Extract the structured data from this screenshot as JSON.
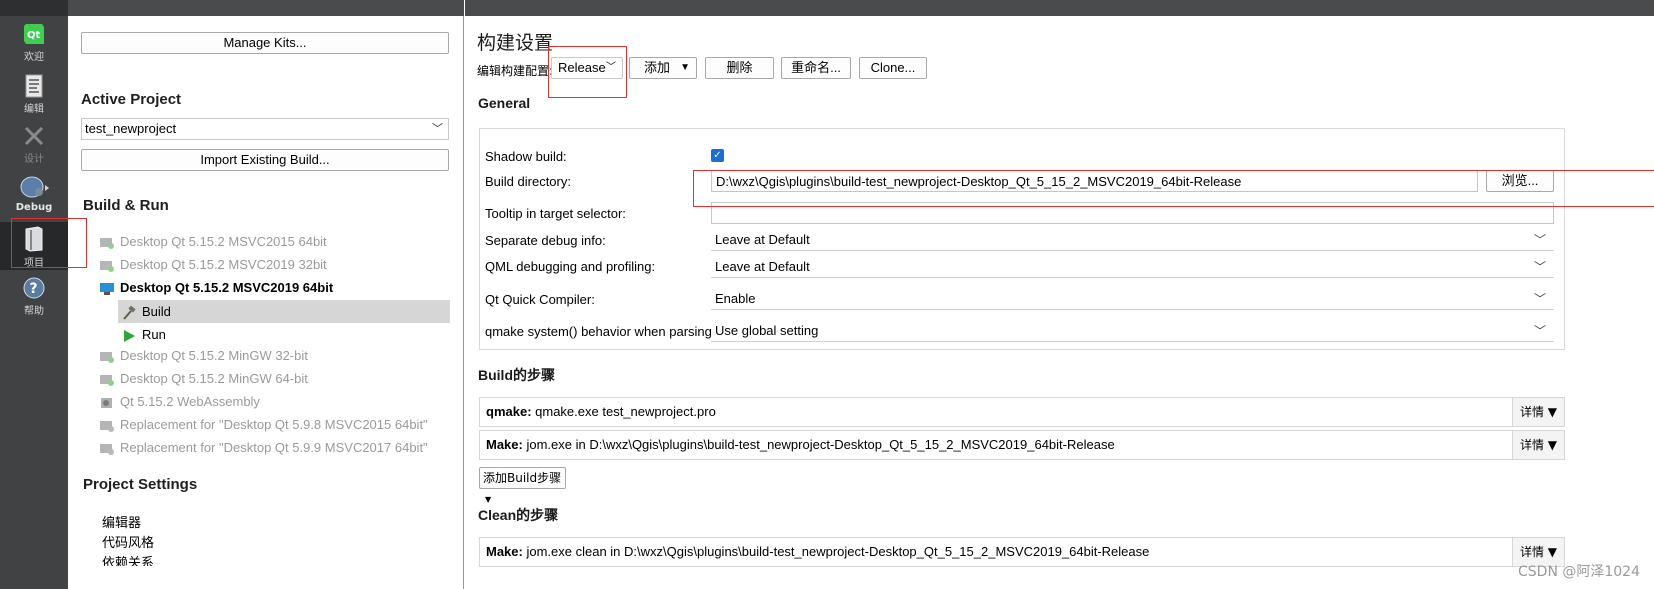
{
  "modebar": {
    "items": [
      {
        "icon": "qt-logo-icon",
        "label": "欢迎"
      },
      {
        "icon": "edit-document-icon",
        "label": "编辑"
      },
      {
        "icon": "design-tools-icon",
        "label": "设计"
      },
      {
        "icon": "debug-bug-icon",
        "label": "Debug"
      },
      {
        "icon": "project-book-icon",
        "label": "项目"
      },
      {
        "icon": "help-question-icon",
        "label": "帮助"
      }
    ]
  },
  "left": {
    "manage_kits_label": "Manage Kits...",
    "active_project_title": "Active Project",
    "project_combo_value": "test_newproject",
    "import_build_label": "Import Existing Build...",
    "build_run_title": "Build & Run",
    "kits": [
      "Desktop Qt 5.15.2 MSVC2015 64bit",
      "Desktop Qt 5.15.2 MSVC2019 32bit",
      "Desktop Qt 5.15.2 MSVC2019 64bit",
      "Desktop Qt 5.15.2 MinGW 32-bit",
      "Desktop Qt 5.15.2 MinGW 64-bit",
      "Qt 5.15.2 WebAssembly",
      "Replacement for \"Desktop Qt 5.9.8 MSVC2015 64bit\"",
      "Replacement for \"Desktop Qt 5.9.9 MSVC2017 64bit\""
    ],
    "build_label": "Build",
    "run_label": "Run",
    "project_settings_title": "Project Settings",
    "settings_items": [
      "编辑器",
      "代码风格",
      "依赖关系"
    ]
  },
  "right": {
    "title": "构建设置",
    "edit_config_label": "编辑构建配置:",
    "config_value": "Release",
    "add_label": "添加",
    "delete_label": "删除",
    "rename_label": "重命名...",
    "clone_label": "Clone...",
    "general_title": "General",
    "shadow_build_label": "Shadow build:",
    "shadow_build_checked": "✓",
    "build_dir_label": "Build directory:",
    "build_dir_value": "D:\\wxz\\Qgis\\plugins\\build-test_newproject-Desktop_Qt_5_15_2_MSVC2019_64bit-Release",
    "browse_label": "浏览...",
    "tooltip_label": "Tooltip in target selector:",
    "tooltip_value": "",
    "sep_debug_label": "Separate debug info:",
    "sep_debug_value": "Leave at Default",
    "qml_debug_label": "QML debugging and profiling:",
    "qml_debug_value": "Leave at Default",
    "qt_quick_label": "Qt Quick Compiler:",
    "qt_quick_value": "Enable",
    "qmake_behavior_label": "qmake system() behavior when parsing:",
    "qmake_behavior_value": "Use global setting",
    "build_steps_title": "Build的步骤",
    "steps": [
      {
        "bold": "qmake:",
        "text": " qmake.exe test_newproject.pro",
        "detail": "详情"
      },
      {
        "bold": "Make:",
        "text": " jom.exe in D:\\wxz\\Qgis\\plugins\\build-test_newproject-Desktop_Qt_5_15_2_MSVC2019_64bit-Release",
        "detail": "详情"
      }
    ],
    "add_build_step_label": "添加Build步骤",
    "clean_steps_title": "Clean的步骤",
    "clean_step": {
      "bold": "Make:",
      "text": " jom.exe clean in D:\\wxz\\Qgis\\plugins\\build-test_newproject-Desktop_Qt_5_15_2_MSVC2019_64bit-Release",
      "detail": "详情"
    }
  },
  "watermark": "CSDN @阿泽1024",
  "colors": {
    "accent": "#1e6ecf",
    "annotation_red": "#e23030",
    "modebar_bg": "#404244"
  }
}
